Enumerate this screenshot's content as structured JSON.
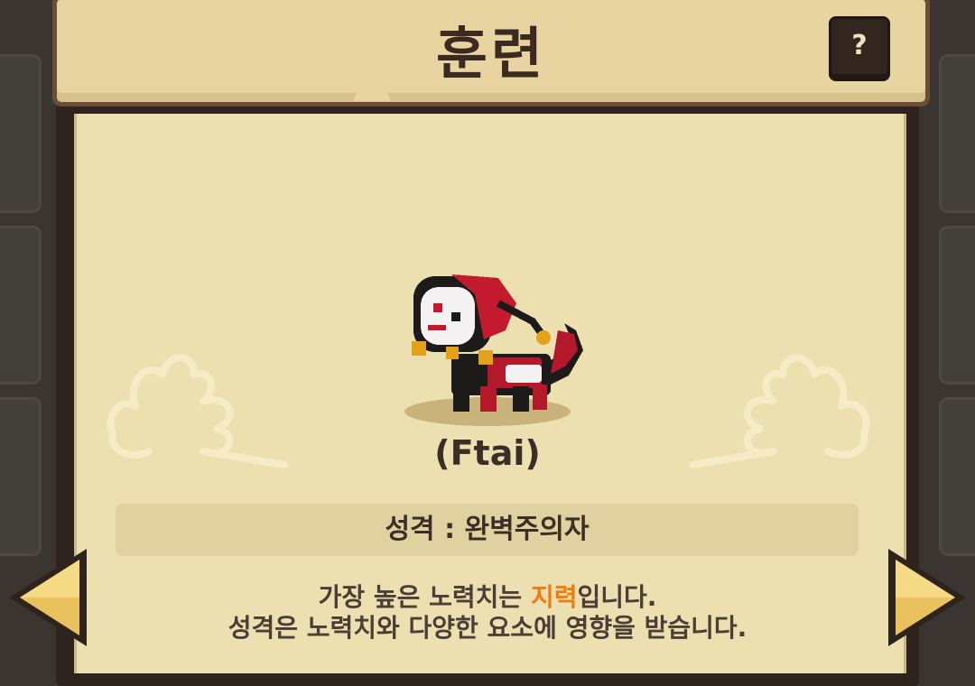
{
  "screen": {
    "title": "훈련",
    "help_label": "?"
  },
  "character": {
    "name": "(Ftai)"
  },
  "personality": {
    "text": "성격 : 완벽주의자"
  },
  "description": {
    "line1_prefix": "가장 높은 노력치는 ",
    "line1_highlight": "지력",
    "line1_suffix": "입니다.",
    "line2": "성격은 노력치와 다양한 요소에 영향을 받습니다."
  },
  "colors": {
    "highlight": "#f07c10",
    "panel": "#ece0b0",
    "title_bar": "#e8d4a0",
    "frame": "#2f241d"
  },
  "icons": {
    "help": "question-icon",
    "prev": "left-arrow-icon",
    "next": "right-arrow-icon"
  }
}
